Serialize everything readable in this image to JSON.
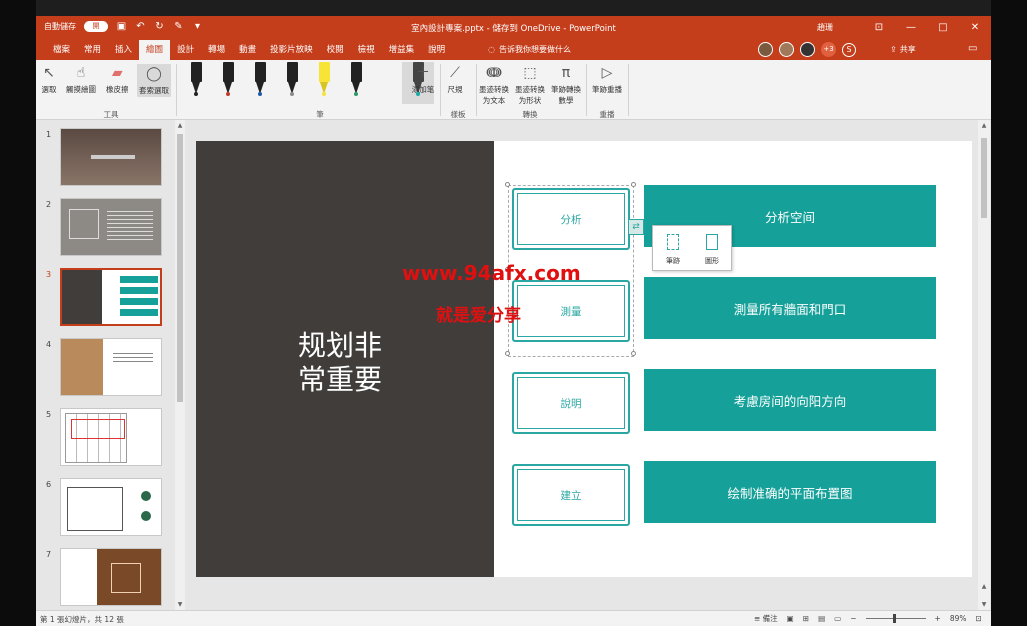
{
  "title_bar": {
    "autosave_label": "自動儲存",
    "autosave_state": "開",
    "doc_title": "室內設計專案.pptx - 儲存到 OneDrive - PowerPoint",
    "user": "趙珊",
    "win_btn_ribbon": "⊡",
    "win_btn_min": "—",
    "win_btn_max": "□",
    "win_btn_close": "✕"
  },
  "tabs": [
    "檔案",
    "常用",
    "插入",
    "繪圖",
    "設計",
    "轉場",
    "動畫",
    "投影片放映",
    "校閱",
    "檢視",
    "增益集",
    "說明"
  ],
  "active_tab_index": 3,
  "tell_me": "告诉我你想要做什么",
  "collab": {
    "extra_count": "+3",
    "skype": "S"
  },
  "share_label": "共享",
  "ribbon": {
    "tools": {
      "select": "選取",
      "touch_draw": "觸摸繪圖",
      "eraser": "橡皮擦",
      "lasso": "套索選取",
      "group": "工具"
    },
    "pens": {
      "group": "筆",
      "items": [
        {
          "color": "#222222"
        },
        {
          "color": "#c0392b"
        },
        {
          "color": "#1e5aa8"
        },
        {
          "color": "#8a8a8a"
        },
        {
          "color": "#f7e436"
        },
        {
          "color": "#2a9a6a"
        },
        {
          "color": "#1aaba6"
        }
      ]
    },
    "add_pen": "添加笔",
    "ruler": "尺規",
    "stencils_group": "樣板",
    "ink_to_text": "墨迹转换为文本",
    "ink_to_shape": "墨迹转换为形状",
    "ink_to_math": "筆跡轉換數學",
    "convert_group": "轉換",
    "ink_replay": "筆跡重播",
    "replay_group": "重播"
  },
  "thumbnails": {
    "numbers": [
      "1",
      "2",
      "3",
      "4",
      "5",
      "6",
      "7"
    ],
    "selected_index": 2
  },
  "slide": {
    "headline_line1": "规划非",
    "headline_line2": "常重要",
    "steps": [
      {
        "label": "分析",
        "detail": "分析空间"
      },
      {
        "label": "測量",
        "detail": "測量所有牆面和門口"
      },
      {
        "label": "說明",
        "detail": "考慮房间的向阳方向"
      },
      {
        "label": "建立",
        "detail": "绘制准确的平面布置图"
      }
    ],
    "popup": {
      "option1": "筆跡",
      "option2": "圖形"
    },
    "watermark_url": "www.94afx.com",
    "watermark_slogan": "就是爱分享"
  },
  "status_bar": {
    "slide_info": "第 1 張幻燈片，共 12 張",
    "notes": "備注",
    "zoom": "89%",
    "zoom_fraction": 0.89
  }
}
